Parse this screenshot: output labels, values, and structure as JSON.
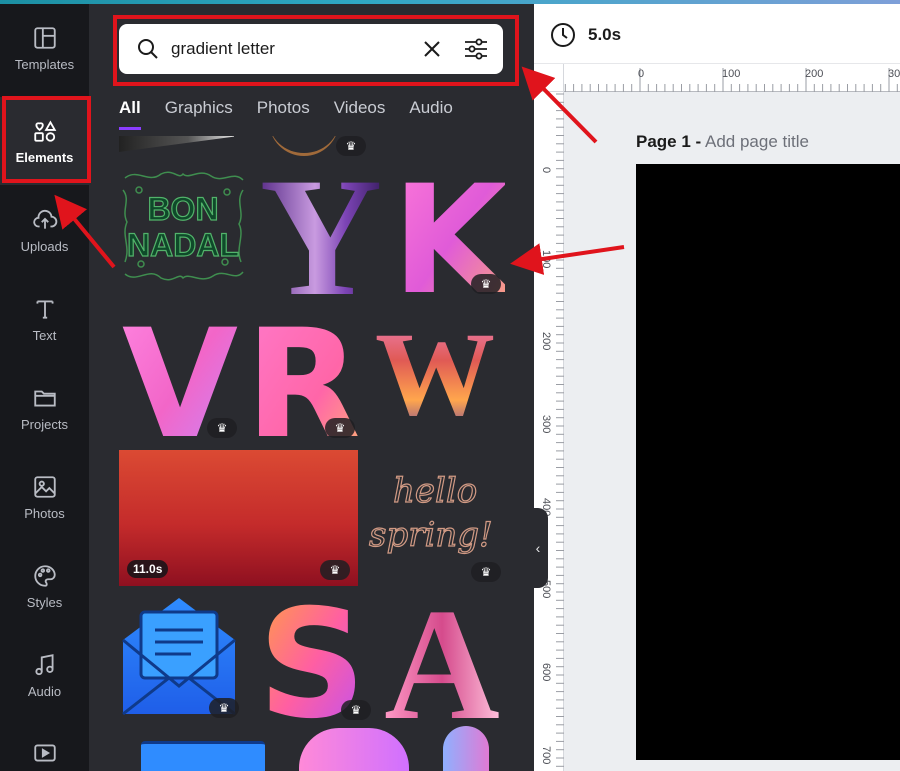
{
  "rail": {
    "items": [
      {
        "label": "Templates",
        "icon": "templates-icon"
      },
      {
        "label": "Elements",
        "icon": "elements-icon"
      },
      {
        "label": "Uploads",
        "icon": "cloud-upload-icon"
      },
      {
        "label": "Text",
        "icon": "text-icon"
      },
      {
        "label": "Projects",
        "icon": "folder-icon"
      },
      {
        "label": "Photos",
        "icon": "photo-icon"
      },
      {
        "label": "Styles",
        "icon": "palette-icon"
      },
      {
        "label": "Audio",
        "icon": "music-note-icon"
      }
    ]
  },
  "search": {
    "value": "gradient letter"
  },
  "tabs": [
    "All",
    "Graphics",
    "Photos",
    "Videos",
    "Audio"
  ],
  "results": {
    "bon_nadal": [
      "BON",
      "NADAL"
    ],
    "letters": [
      "Y",
      "K",
      "V",
      "R",
      "W",
      "S",
      "A"
    ],
    "hello_spring": [
      "hello",
      "spring!"
    ],
    "video_duration": "11.0s"
  },
  "topbar": {
    "duration": "5.0s"
  },
  "ruler": {
    "top": [
      "0",
      "100",
      "200",
      "30"
    ],
    "left": [
      "0",
      "100",
      "200",
      "300",
      "400",
      "500",
      "600",
      "700"
    ]
  },
  "page": {
    "label": "Page 1 -",
    "placeholder": "Add page title"
  },
  "colors": {
    "accent": "#8b3dff",
    "annotation": "#e0141c"
  }
}
